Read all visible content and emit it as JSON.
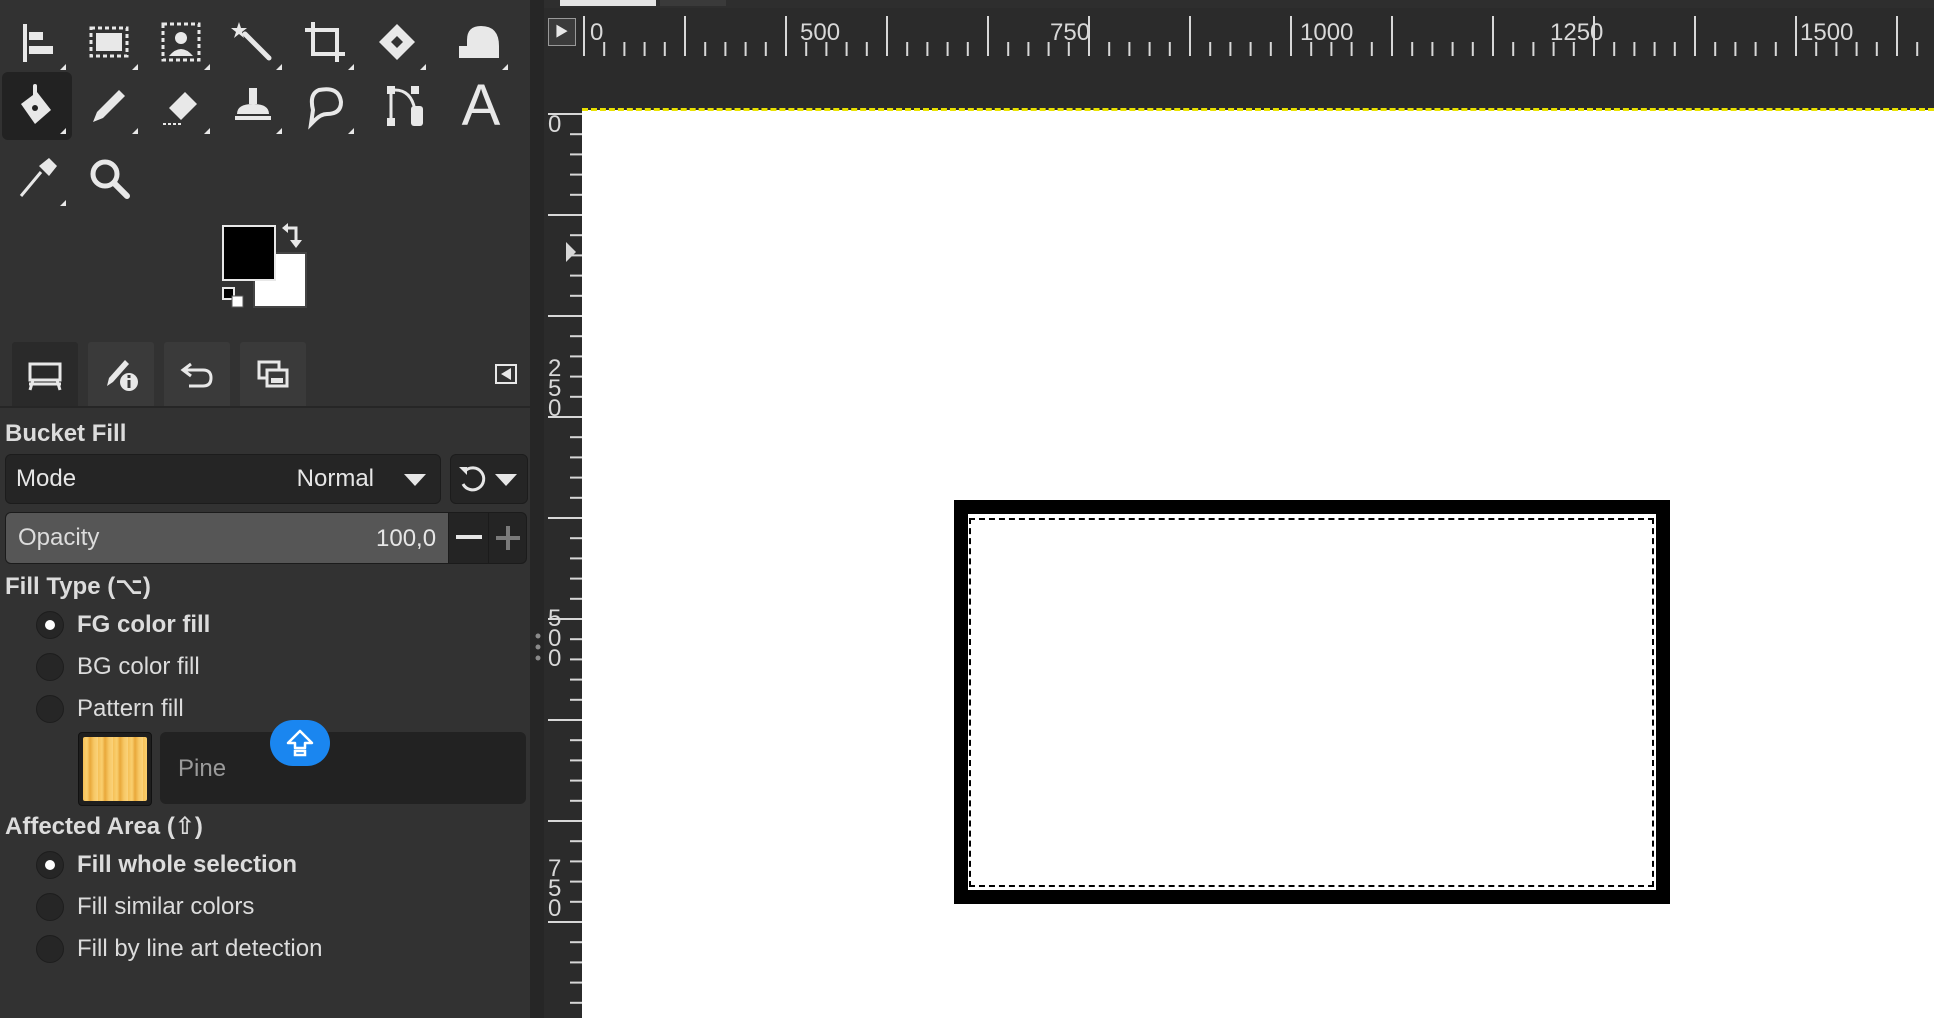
{
  "toolbox": {
    "tools": [
      {
        "name": "align-tool",
        "icon": "align-icon",
        "active": false
      },
      {
        "name": "rect-select-tool",
        "icon": "rect-select-icon",
        "active": false
      },
      {
        "name": "foreground-select-tool",
        "icon": "foreground-select-icon",
        "active": false
      },
      {
        "name": "fuzzy-select-tool",
        "icon": "magic-wand-icon",
        "active": false
      },
      {
        "name": "crop-tool",
        "icon": "crop-icon",
        "active": false
      },
      {
        "name": "unified-transform-tool",
        "icon": "transform-icon",
        "active": false
      },
      {
        "name": "warp-transform-tool",
        "icon": "warp-icon",
        "active": false
      },
      {
        "name": "bucket-fill-tool",
        "icon": "bucket-fill-icon",
        "active": true
      },
      {
        "name": "pencil-tool",
        "icon": "pencil-icon",
        "active": false
      },
      {
        "name": "eraser-tool",
        "icon": "eraser-icon",
        "active": false
      },
      {
        "name": "clone-tool",
        "icon": "clone-stamp-icon",
        "active": false
      },
      {
        "name": "smudge-tool",
        "icon": "smudge-icon",
        "active": false
      },
      {
        "name": "paths-tool",
        "icon": "paths-icon",
        "active": false
      },
      {
        "name": "text-tool",
        "icon": "text-icon",
        "active": false,
        "glyph": "A"
      },
      {
        "name": "color-picker-tool",
        "icon": "eyedropper-icon",
        "active": false
      },
      {
        "name": "zoom-tool",
        "icon": "zoom-icon",
        "active": false
      }
    ],
    "colors": {
      "foreground": "#000000",
      "background": "#ffffff"
    }
  },
  "dock": {
    "tabs": [
      {
        "name": "tool-options-tab",
        "icon": "tool-options-icon",
        "active": true
      },
      {
        "name": "device-status-tab",
        "icon": "device-status-icon",
        "active": false
      },
      {
        "name": "undo-history-tab",
        "icon": "undo-history-icon",
        "active": false
      },
      {
        "name": "images-tab",
        "icon": "images-icon",
        "active": false
      }
    ]
  },
  "tool_options": {
    "title": "Bucket Fill",
    "mode_label": "Mode",
    "mode_value": "Normal",
    "opacity_label": "Opacity",
    "opacity_value": "100,0",
    "opacity_fraction": 1.0,
    "fill_type_title": "Fill Type  (⌥)",
    "fill_type_options": [
      "FG color fill",
      "BG color fill",
      "Pattern fill"
    ],
    "fill_type_selected": 0,
    "pattern_name": "Pine",
    "affected_area_title": "Affected Area  (⇧)",
    "affected_area_options": [
      "Fill whole selection",
      "Fill similar colors",
      "Fill by line art detection"
    ],
    "affected_area_selected": 0
  },
  "rulers": {
    "horizontal_labels": [
      "0",
      "500",
      "750",
      "1000",
      "1250",
      "1500"
    ],
    "vertical_labels": [
      "0",
      "250",
      "500",
      "750"
    ]
  },
  "colors": {
    "ui_bg": "#323232",
    "canvas_bg": "#2b2b2b",
    "accent": "#1a86f0",
    "selection_yellow": "#e8e100"
  }
}
